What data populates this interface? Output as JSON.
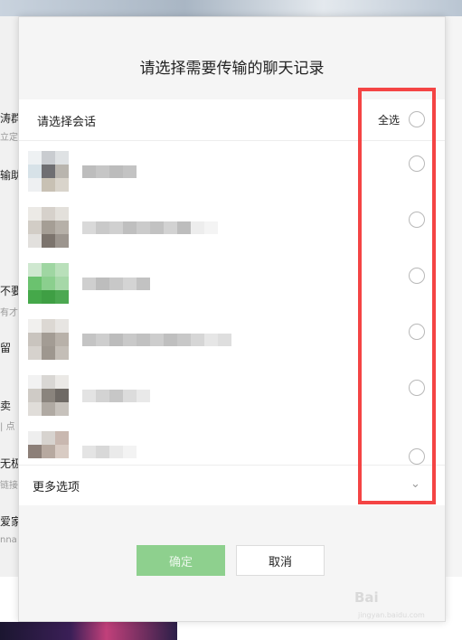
{
  "dialog": {
    "title": "请选择需要传输的聊天记录",
    "select_label": "请选择会话",
    "select_all": "全选",
    "more_options": "更多选项",
    "confirm": "确定",
    "cancel": "取消"
  },
  "background": {
    "chat_fragments": [
      "涛群",
      "立定",
      "输助",
      "不要",
      "有才",
      "留",
      "卖",
      "| 点",
      "无极",
      "链接",
      "爱家",
      "nna"
    ]
  },
  "watermark": {
    "brand": "Bai",
    "sub": "jingyan.baidu.com"
  },
  "colors": {
    "confirm_button": "#8ed08e",
    "highlight_border": "#f44444",
    "dialog_bg": "#f5f5f5"
  }
}
